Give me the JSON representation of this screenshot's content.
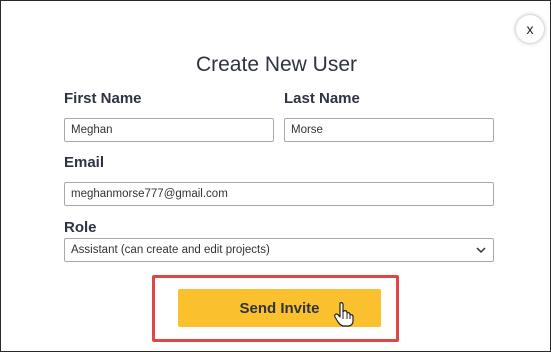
{
  "dialog": {
    "title": "Create New User",
    "close_label": "x"
  },
  "form": {
    "first_name": {
      "label": "First Name",
      "value": "Meghan"
    },
    "last_name": {
      "label": "Last Name",
      "value": "Morse"
    },
    "email": {
      "label": "Email",
      "value": "meghanmorse777@gmail.com"
    },
    "role": {
      "label": "Role",
      "value": "Assistant (can create and edit projects)"
    }
  },
  "actions": {
    "send_label": "Send Invite"
  },
  "colors": {
    "button": "#fbc02d",
    "highlight": "#e04646",
    "text": "#2f3342"
  },
  "icons": {
    "close": "close-icon",
    "dropdown": "chevron-down-icon",
    "cursor": "hand-pointer-icon"
  }
}
